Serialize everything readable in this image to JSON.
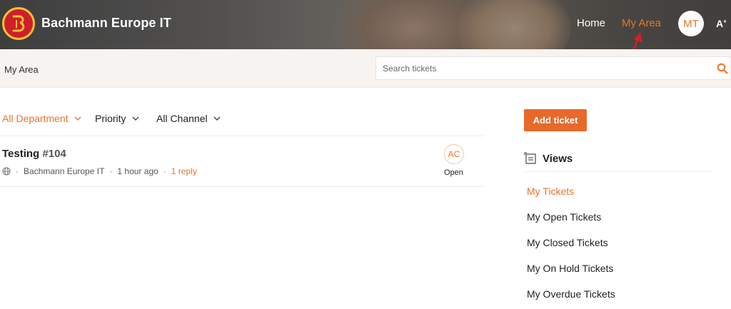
{
  "header": {
    "brand": "Bachmann Europe IT",
    "nav_home": "Home",
    "nav_my_area": "My Area",
    "avatar_initials": "MT",
    "a11y_label": "A",
    "a11y_sup": "+"
  },
  "subbar": {
    "breadcrumb": "My Area",
    "search_placeholder": "Search tickets"
  },
  "filters": {
    "department": "All Department",
    "priority": "Priority",
    "channel": "All Channel"
  },
  "ticket": {
    "title": "Testing",
    "id": "#104",
    "organization": "Bachmann Europe IT",
    "time": "1 hour ago",
    "replies": "1 reply",
    "assignee_initials": "AC",
    "status": "Open"
  },
  "sidebar": {
    "add_ticket": "Add ticket",
    "views_title": "Views",
    "views": [
      "My Tickets",
      "My Open Tickets",
      "My Closed Tickets",
      "My On Hold Tickets",
      "My Overdue Tickets"
    ]
  },
  "colors": {
    "accent": "#e8742a",
    "button": "#e8692a",
    "logo_red": "#d01e2b",
    "logo_yellow": "#f2c12e"
  },
  "icons": [
    "logo-icon",
    "search-icon",
    "chevron-down-icon",
    "globe-icon",
    "views-icon",
    "arrow-annotation"
  ]
}
